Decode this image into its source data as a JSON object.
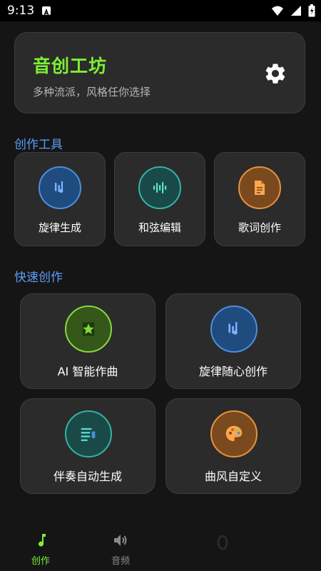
{
  "status_bar": {
    "time": "9:13"
  },
  "header": {
    "title": "音创工坊",
    "subtitle": "多种流派，风格任你选择",
    "settings_icon": "gear-icon"
  },
  "sections": {
    "tools_title": "创作工具",
    "quick_title": "快速创作"
  },
  "tools": [
    {
      "label": "旋律生成",
      "icon": "melody-icon",
      "color": "#4c8ee0"
    },
    {
      "label": "和弦编辑",
      "icon": "waveform-icon",
      "color": "#33b3a3"
    },
    {
      "label": "歌词创作",
      "icon": "document-icon",
      "color": "#e8923d"
    }
  ],
  "quick": [
    {
      "label": "AI 智能作曲",
      "icon": "ai-star-icon",
      "color": "#84d93f"
    },
    {
      "label": "旋律随心创作",
      "icon": "melody-icon",
      "color": "#4c8ee0"
    },
    {
      "label": "伴奏自动生成",
      "icon": "list-music-icon",
      "color": "#33b3a3"
    },
    {
      "label": "曲风自定义",
      "icon": "palette-icon",
      "color": "#e8923d"
    }
  ],
  "nav": [
    {
      "label": "创作",
      "icon": "music-note-icon",
      "active": true
    },
    {
      "label": "音频",
      "icon": "speaker-icon",
      "active": false
    }
  ],
  "colors": {
    "accent_green": "#7cf032",
    "section_blue": "#5b9ef7",
    "card_bg": "#2b2b2b",
    "page_bg": "#151515"
  }
}
